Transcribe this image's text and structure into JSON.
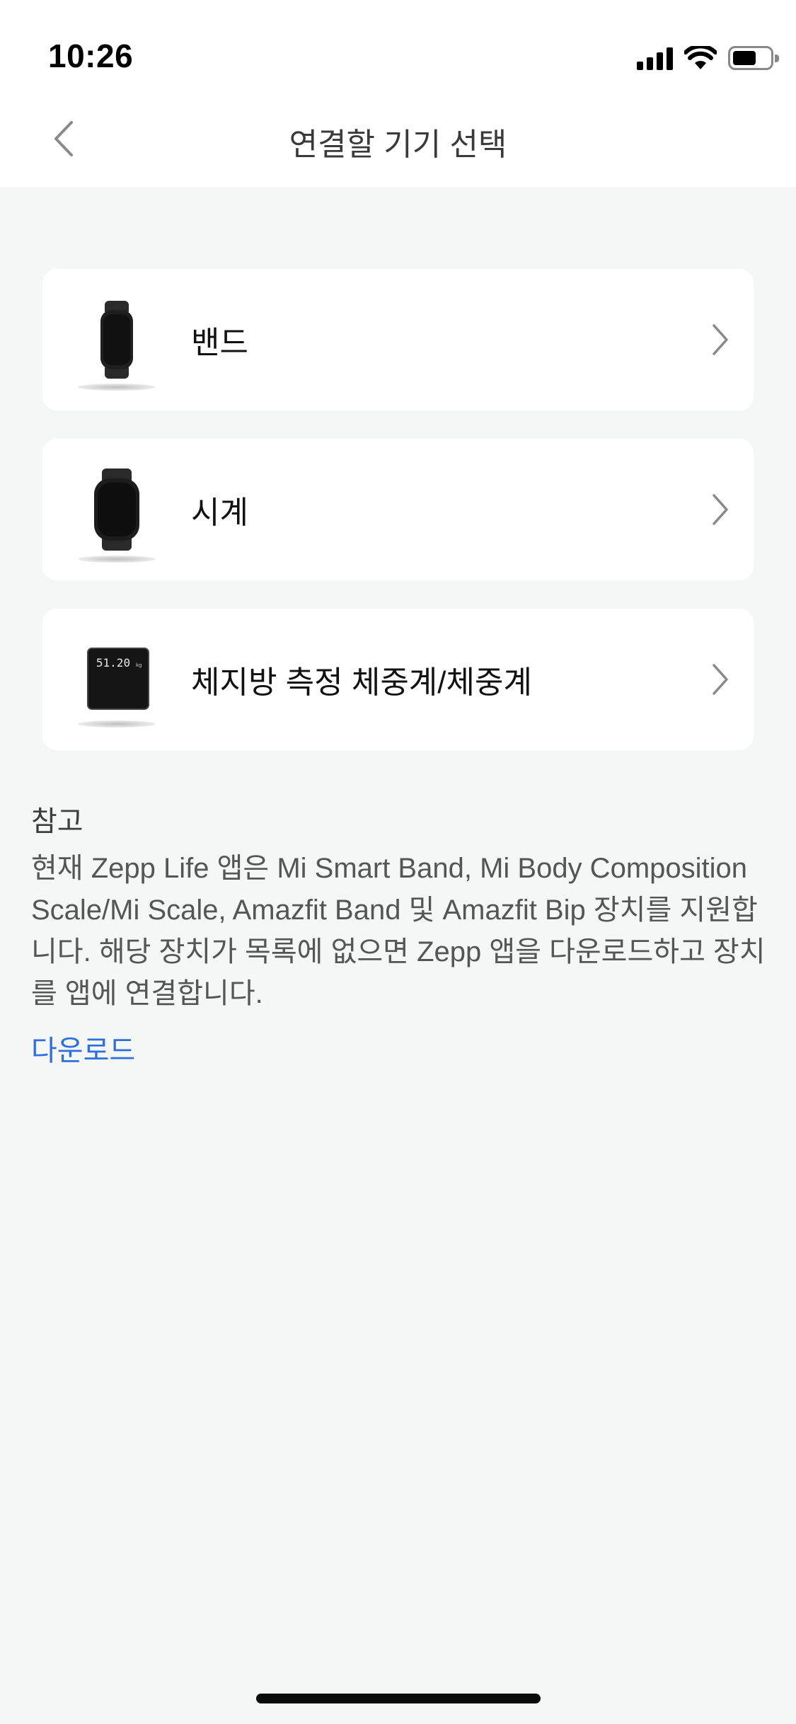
{
  "status_bar": {
    "time": "10:26",
    "icons": [
      "signal-icon",
      "wifi-icon",
      "battery-icon"
    ]
  },
  "header": {
    "title": "연결할 기기 선택",
    "back_icon": "chevron-left-icon"
  },
  "devices": [
    {
      "label": "밴드",
      "icon": "band-icon"
    },
    {
      "label": "시계",
      "icon": "watch-icon"
    },
    {
      "label": "체지방 측정 체중계/체중계",
      "icon": "scale-icon",
      "scale_readout": "51.20"
    }
  ],
  "note": {
    "title": "참고",
    "body": "현재 Zepp Life 앱은 Mi Smart Band, Mi Body Composition Scale/Mi Scale, Amazfit Band 및 Amazfit Bip 장치를 지원합니다. 해당 장치가 목록에 없으면 Zepp 앱을 다운로드하고 장치를 앱에 연결합니다.",
    "download_label": "다운로드"
  },
  "colors": {
    "background": "#f5f6f6",
    "card": "#ffffff",
    "link": "#2f6fdb",
    "text": "#1c1c1c"
  }
}
